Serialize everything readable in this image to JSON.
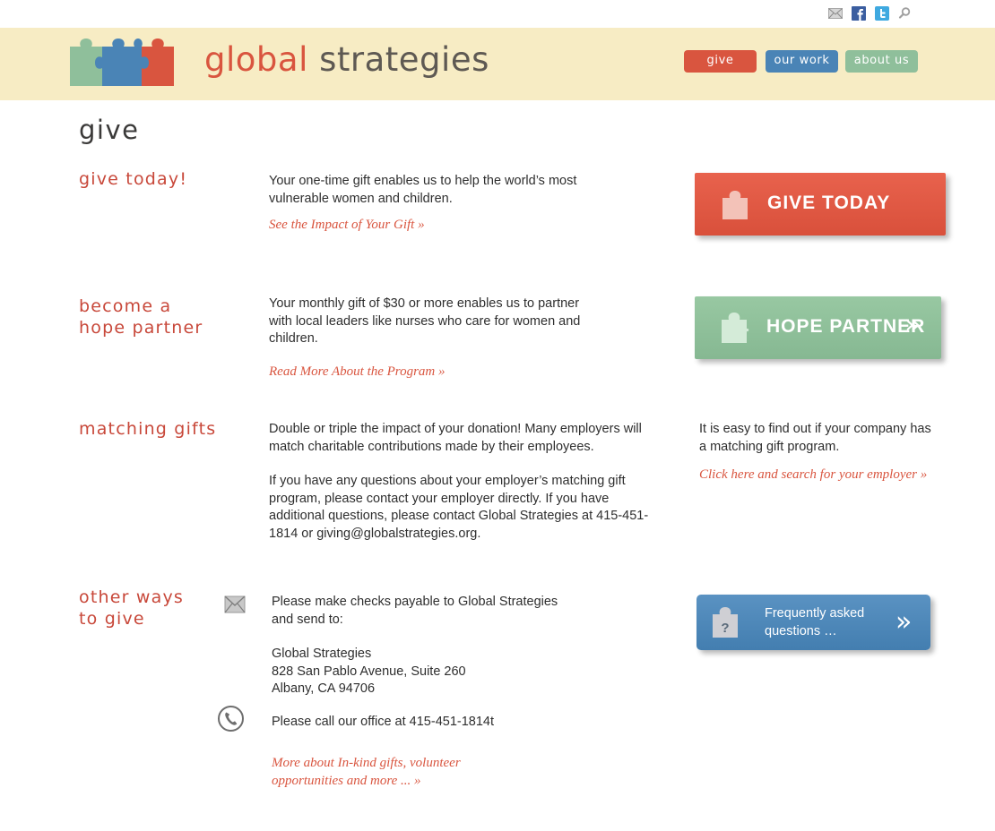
{
  "utility": {
    "icons": [
      "mail-icon",
      "facebook-icon",
      "twitter-icon",
      "search-icon"
    ]
  },
  "header": {
    "logo_word1": "global",
    "logo_word2": "strategies",
    "nav": [
      {
        "label": "give",
        "color": "#d9553f"
      },
      {
        "label": "our work",
        "color": "#4a84b6"
      },
      {
        "label": "about us",
        "color": "#8fbf9b"
      }
    ]
  },
  "page": {
    "title": "give"
  },
  "sections": {
    "give_today": {
      "heading": "give today!",
      "text": "Your one-time gift enables us to help the world’s most vulnerable women and children.",
      "link": "See the Impact of Your Gift »",
      "button": "GIVE TODAY"
    },
    "hope_partner": {
      "heading_line1": "become a",
      "heading_line2": "hope partner",
      "text": "Your monthly gift of $30 or more enables us to partner with local leaders like nurses who care for women and children.",
      "link": "Read More About the Program »",
      "button": "HOPE PARTNER",
      "chevron": "»"
    },
    "matching_gifts": {
      "heading": "matching gifts",
      "text1": "Double or triple the impact of your donation! Many employers will match charitable contributions made by their employees.",
      "text2": "If you have any questions about your employer’s matching gift program, please contact your employer directly. If you have additional questions, please contact Global Strategies at 415-451-1814 or giving@globalstrategies.org.",
      "side_text": "It is easy to  find out if your company has a matching gift program.",
      "side_link": "Click here and search for your employer »"
    },
    "other_ways": {
      "heading_line1": "other ways",
      "heading_line2": "to give",
      "mail_line1": "Please make checks payable to Global Strategies",
      "mail_line2": "and send to:",
      "address_line1": "Global Strategies",
      "address_line2": "828 San Pablo Avenue, Suite 260",
      "address_line3": "Albany, CA 94706",
      "phone_text": "Please call our office at 415-451-1814t",
      "link_line1": "More about In-kind gifts, volunteer",
      "link_line2": "opportunities and more ... »",
      "faq_line1": "Frequently asked",
      "faq_line2": "questions …",
      "faq_chevron": "»"
    }
  },
  "colors": {
    "accent_red": "#d9553f",
    "accent_blue": "#4a84b6",
    "accent_green": "#8fbf9b",
    "header_bg": "#f7ecc4"
  }
}
